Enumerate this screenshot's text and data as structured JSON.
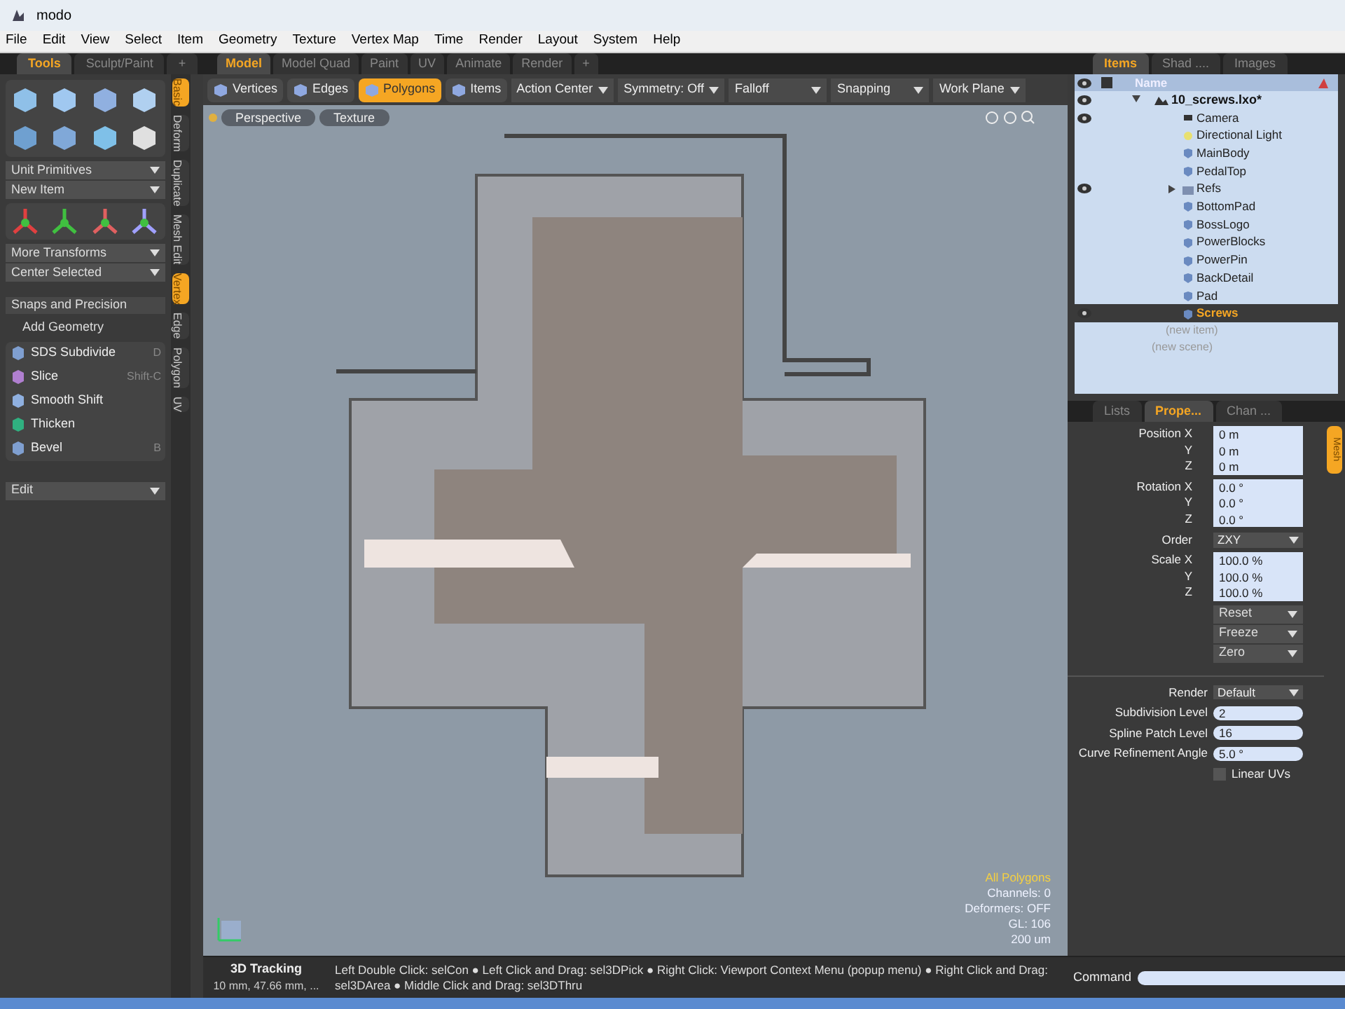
{
  "window": {
    "title": "modo"
  },
  "menu": [
    "File",
    "Edit",
    "View",
    "Select",
    "Item",
    "Geometry",
    "Texture",
    "Vertex Map",
    "Time",
    "Render",
    "Layout",
    "System",
    "Help"
  ],
  "tool_tabs": [
    {
      "label": "Tools",
      "selected": true
    },
    {
      "label": "Sculpt/Paint",
      "selected": false
    },
    {
      "label": "+",
      "selected": false
    }
  ],
  "layout_tabs": [
    {
      "label": "Model",
      "selected": true
    },
    {
      "label": "Model Quad",
      "selected": false
    },
    {
      "label": "Paint",
      "selected": false
    },
    {
      "label": "UV",
      "selected": false
    },
    {
      "label": "Animate",
      "selected": false
    },
    {
      "label": "Render",
      "selected": false
    },
    {
      "label": "+",
      "selected": false
    }
  ],
  "tools": {
    "dropdowns_a": [
      "Unit Primitives",
      "New Item"
    ],
    "dropdowns_b": [
      "More Transforms",
      "Center Selected"
    ],
    "section": "Snaps and Precision",
    "subheading": "Add Geometry",
    "items": [
      {
        "label": "SDS Subdivide",
        "shortcut": "D",
        "color": "#7f9fd0"
      },
      {
        "label": "Slice",
        "shortcut": "Shift-C",
        "color": "#b07fd0"
      },
      {
        "label": "Smooth Shift",
        "color": "#8fb0e0"
      },
      {
        "label": "Thicken",
        "color": "#30b080"
      },
      {
        "label": "Bevel",
        "shortcut": "B",
        "color": "#7f9fd0"
      }
    ],
    "bottom_dropdown": "Edit"
  },
  "side_tabs": [
    {
      "label": "Basic",
      "selected": true
    },
    {
      "label": "Deform",
      "selected": false
    },
    {
      "label": "Duplicate",
      "selected": false
    },
    {
      "label": "Mesh Edit",
      "selected": false
    },
    {
      "label": "Vertex",
      "selected": true
    },
    {
      "label": "Edge",
      "selected": false
    },
    {
      "label": "Polygon",
      "selected": false
    },
    {
      "label": "UV",
      "selected": false
    }
  ],
  "modes": [
    {
      "label": "Vertices",
      "selected": false
    },
    {
      "label": "Edges",
      "selected": false
    },
    {
      "label": "Polygons",
      "selected": true
    },
    {
      "label": "Items",
      "selected": false
    }
  ],
  "toolbar_dropdowns": [
    "Action Center",
    "Symmetry: Off",
    "Falloff",
    "Snapping",
    "Work Plane"
  ],
  "viewport": {
    "view_buttons": [
      "Perspective",
      "Texture"
    ],
    "info": [
      {
        "text": "All Polygons",
        "kind": "highlight"
      },
      {
        "text": "Channels: 0",
        "kind": "plain"
      },
      {
        "text": "Deformers: OFF",
        "kind": "plain"
      },
      {
        "text": "GL: 106",
        "kind": "plain"
      },
      {
        "text": "200 um",
        "kind": "plain"
      }
    ]
  },
  "items_tabs": [
    {
      "label": "Items",
      "selected": true
    },
    {
      "label": "Shad ....",
      "selected": false
    },
    {
      "label": "Images",
      "selected": false
    }
  ],
  "items_header": "Name",
  "scene": {
    "label": "10_screws.lxo*",
    "visible": true,
    "expanded": true,
    "children": [
      {
        "label": "Camera",
        "kind": "camera",
        "visible": true,
        "selected": false
      },
      {
        "label": "Directional Light",
        "kind": "light",
        "visible": false,
        "selected": false
      },
      {
        "label": "MainBody",
        "kind": "mesh",
        "visible": false,
        "selected": false
      },
      {
        "label": "PedalTop",
        "kind": "mesh",
        "visible": false,
        "selected": false
      },
      {
        "label": "Refs",
        "kind": "group",
        "visible": true,
        "selected": false,
        "expanded": false
      },
      {
        "label": "BottomPad",
        "kind": "mesh",
        "visible": false,
        "selected": false
      },
      {
        "label": "BossLogo",
        "kind": "mesh",
        "visible": false,
        "selected": false
      },
      {
        "label": "PowerBlocks",
        "kind": "mesh",
        "visible": false,
        "selected": false
      },
      {
        "label": "PowerPin",
        "kind": "mesh",
        "visible": false,
        "selected": false
      },
      {
        "label": "BackDetail",
        "kind": "mesh",
        "visible": false,
        "selected": false
      },
      {
        "label": "Pad",
        "kind": "mesh",
        "visible": false,
        "selected": false
      },
      {
        "label": "Screws",
        "kind": "mesh",
        "visible": true,
        "selected": true
      }
    ]
  },
  "new_item": "(new item)",
  "new_scene": "(new scene)",
  "props_tabs": [
    {
      "label": "Lists",
      "selected": false
    },
    {
      "label": "Prope...",
      "selected": true
    },
    {
      "label": "Chan ...",
      "selected": false
    }
  ],
  "side_badge": "Mesh",
  "transform": [
    {
      "label": "Position",
      "rows": [
        {
          "axis": "X",
          "value": "0 m"
        },
        {
          "axis": "Y",
          "value": "0 m"
        },
        {
          "axis": "Z",
          "value": "0 m"
        }
      ]
    },
    {
      "label": "Rotation",
      "rows": [
        {
          "axis": "X",
          "value": "0.0 °"
        },
        {
          "axis": "Y",
          "value": "0.0 °"
        },
        {
          "axis": "Z",
          "value": "0.0 °"
        }
      ]
    },
    {
      "label": "Order",
      "dropdown": "ZXY"
    },
    {
      "label": "Scale",
      "rows": [
        {
          "axis": "X",
          "value": "100.0 %"
        },
        {
          "axis": "Y",
          "value": "100.0 %"
        },
        {
          "axis": "Z",
          "value": "100.0 %"
        }
      ]
    }
  ],
  "transform_actions": [
    "Reset",
    "Freeze",
    "Zero"
  ],
  "mesh_props": [
    {
      "label": "Render",
      "kind": "dropdown",
      "value": "Default"
    },
    {
      "label": "Subdivision Level",
      "kind": "field",
      "value": "2"
    },
    {
      "label": "Spline Patch Level",
      "kind": "field",
      "value": "16"
    },
    {
      "label": "Curve Refinement Angle",
      "kind": "field",
      "value": "5.0 °"
    },
    {
      "label": "Linear UVs",
      "kind": "checkbox",
      "checked": false
    }
  ],
  "status": {
    "title": "3D Tracking",
    "coords": "10 mm, 47.66 mm, ...",
    "hint": "Left Double Click: selCon ● Left Click and Drag: sel3DPick ● Right Click: Viewport Context Menu (popup menu) ● Right Click and Drag: sel3DArea ● Middle Click and Drag: sel3DThru"
  },
  "command": {
    "label": "Command"
  }
}
